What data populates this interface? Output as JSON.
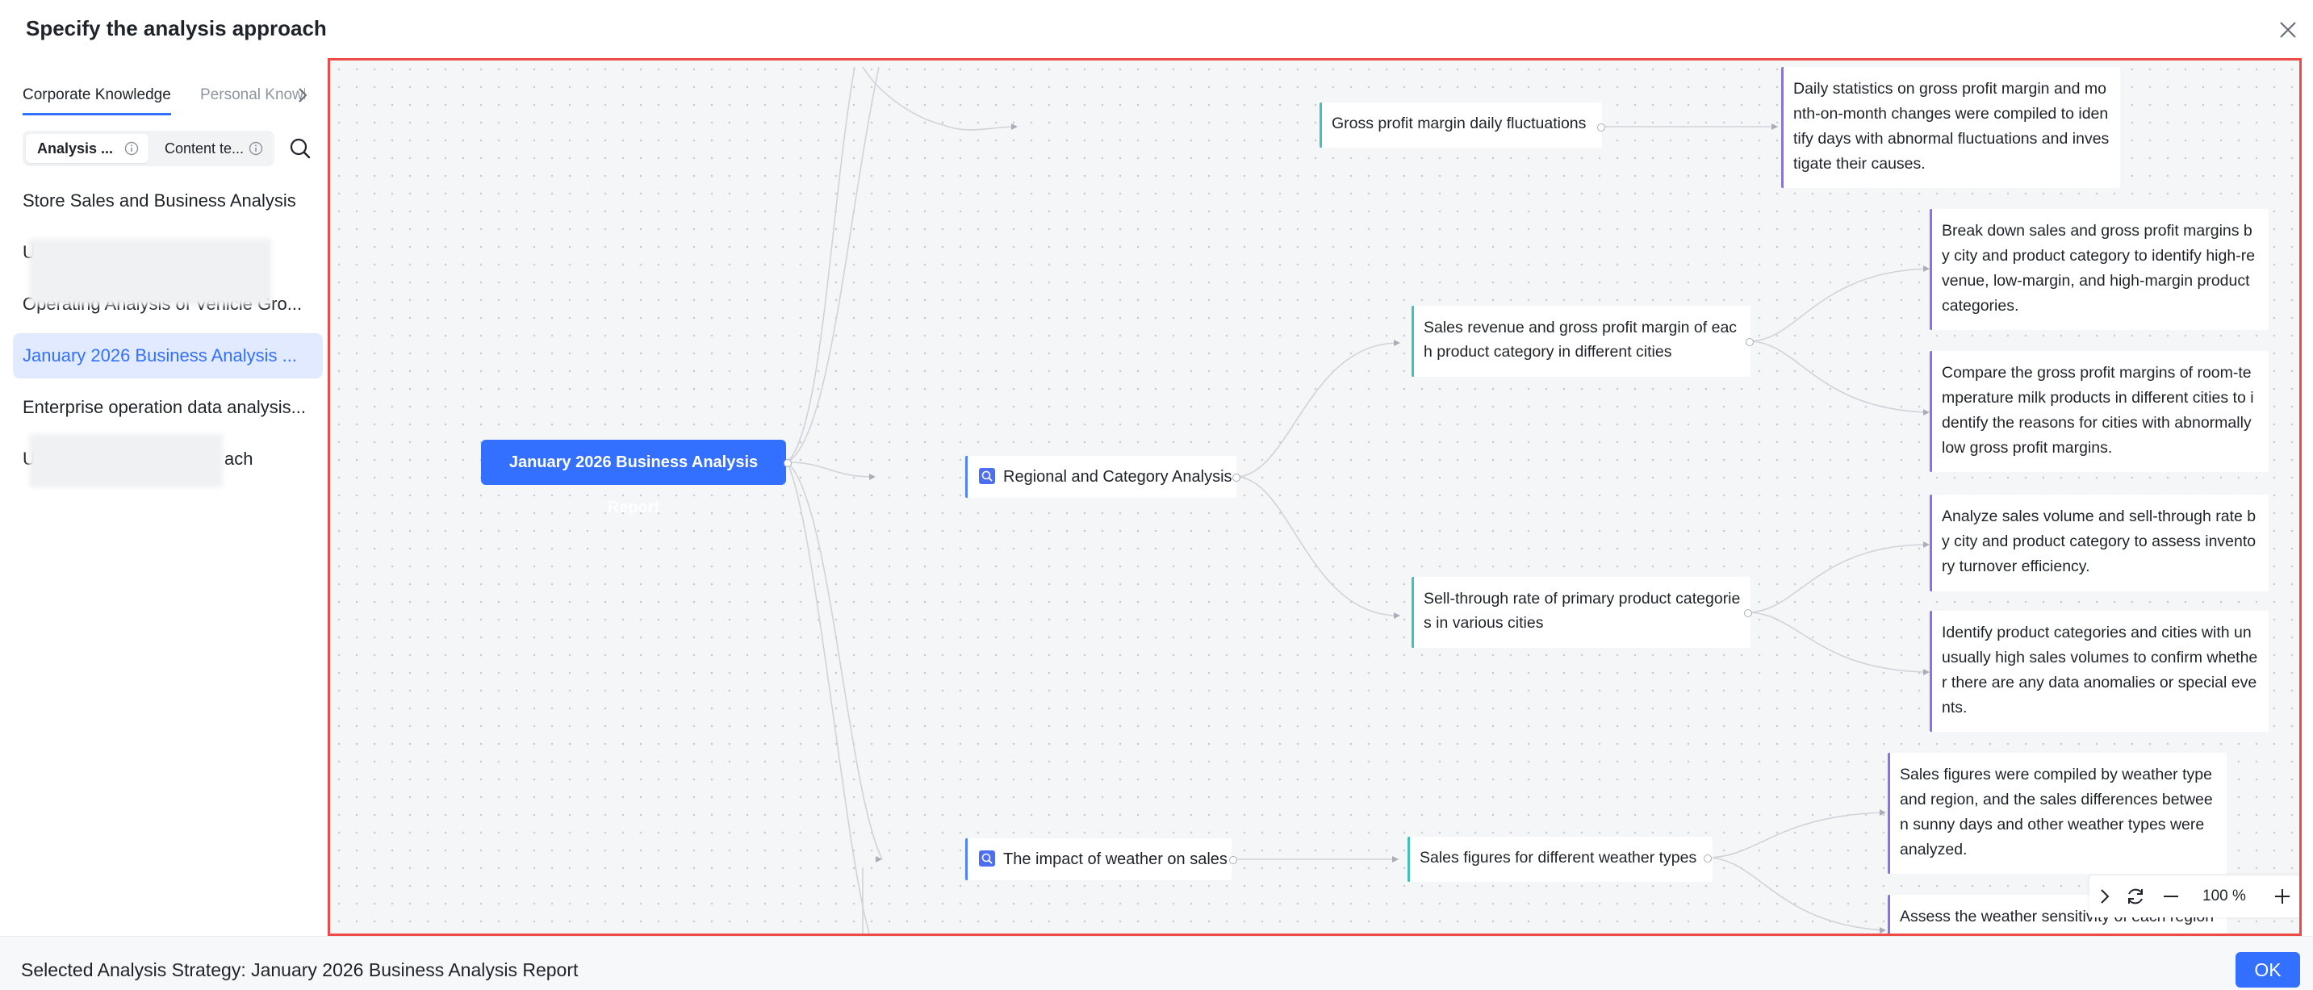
{
  "dialog": {
    "title": "Specify the analysis approach",
    "close_icon": "close-icon"
  },
  "sidebar": {
    "tabs": [
      {
        "label": "Corporate Knowledge",
        "active": true
      },
      {
        "label": "Personal Knowledge",
        "active": false
      }
    ],
    "segments": [
      {
        "label": "Analysis ...",
        "active": true
      },
      {
        "label": "Content te...",
        "active": false
      }
    ],
    "items": [
      {
        "label": "Store Sales and Business Analysis",
        "selected": false
      },
      {
        "label": "U",
        "selected": false,
        "obscured": true
      },
      {
        "label": "Operating Analysis of Vehicle Gro...",
        "selected": false,
        "obscured": true
      },
      {
        "label": "January 2026 Business Analysis ...",
        "selected": true
      },
      {
        "label": "Enterprise operation data analysis...",
        "selected": false
      },
      {
        "label": "U",
        "label_end": "ach",
        "selected": false,
        "obscured": true
      }
    ]
  },
  "mindmap": {
    "root": "January 2026 Business Analysis Report",
    "level1": [
      {
        "label": "Regional and Category Analysis",
        "icon": "analysis-icon"
      },
      {
        "label": "The impact of weather on sales",
        "icon": "analysis-icon"
      }
    ],
    "level2": [
      {
        "label": "Gross profit margin daily fluctuations"
      },
      {
        "label": "Sales revenue and gross profit margin of each product category in different cities"
      },
      {
        "label": "Sell-through rate of primary product categories in various cities"
      },
      {
        "label": "Sales figures for different weather types"
      }
    ],
    "level3": [
      {
        "label": "Daily statistics on gross profit margin and month-on-month changes were compiled to identify days with abnormal fluctuations and investigate their causes."
      },
      {
        "label": "Break down sales and gross profit margins by city and product category to identify high-revenue, low-margin, and high-margin product categories."
      },
      {
        "label": "Compare the gross profit margins of room-temperature milk products in different cities to identify the reasons for cities with abnormally low gross profit margins."
      },
      {
        "label": "Analyze sales volume and sell-through rate by city and product category to assess inventory turnover efficiency."
      },
      {
        "label": "Identify product categories and cities with unusually high sales volumes to confirm whether there are any data anomalies or special events."
      },
      {
        "label": "Sales figures were compiled by weather type and region, and the sales differences between sunny days and other weather types were analyzed."
      },
      {
        "label": "Assess the weather sensitivity of each region"
      }
    ],
    "zoom": {
      "value": "100 %"
    }
  },
  "footer": {
    "selected_text": "Selected Analysis Strategy: January 2026 Business Analysis Report",
    "ok_label": "OK"
  },
  "colors": {
    "accent": "#3370ff",
    "highlight_border": "#ee4b46",
    "selected_bg": "#e1eaff"
  }
}
